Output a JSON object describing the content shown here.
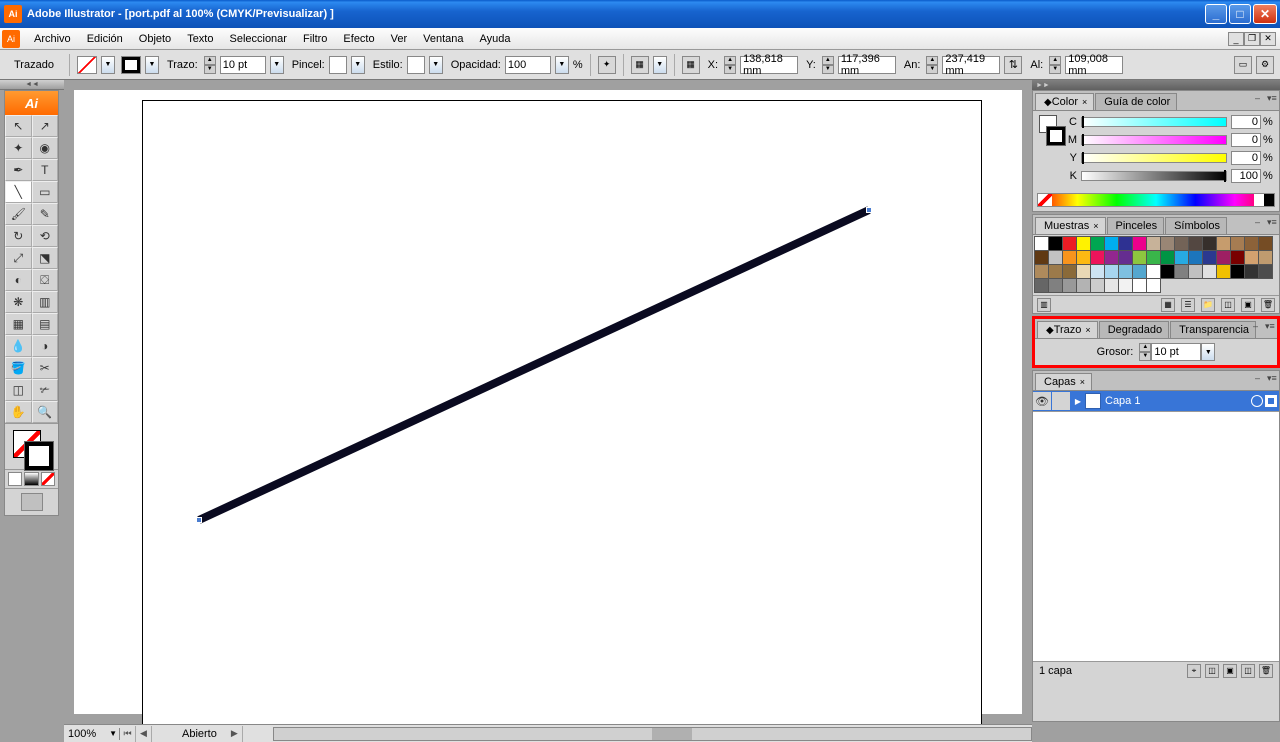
{
  "title": "Adobe Illustrator - [port.pdf al 100% (CMYK/Previsualizar) ]",
  "menu": [
    "Archivo",
    "Edición",
    "Objeto",
    "Texto",
    "Seleccionar",
    "Filtro",
    "Efecto",
    "Ver",
    "Ventana",
    "Ayuda"
  ],
  "control": {
    "selection": "Trazado",
    "trazo_label": "Trazo:",
    "trazo_value": "10 pt",
    "pincel_label": "Pincel:",
    "estilo_label": "Estilo:",
    "opacidad_label": "Opacidad:",
    "opacidad_value": "100",
    "opacidad_unit": "%",
    "x_label": "X:",
    "x_value": "138,818 mm",
    "y_label": "Y:",
    "y_value": "117,396 mm",
    "w_label": "An:",
    "w_value": "237,419 mm",
    "h_label": "Al:",
    "h_value": "109,008 mm"
  },
  "panels": {
    "color": {
      "tabs": [
        "Color",
        "Guía de color"
      ],
      "channels": [
        {
          "label": "C",
          "value": "0"
        },
        {
          "label": "M",
          "value": "0"
        },
        {
          "label": "Y",
          "value": "0"
        },
        {
          "label": "K",
          "value": "100"
        }
      ],
      "pct": "%"
    },
    "swatches": {
      "tabs": [
        "Muestras",
        "Pinceles",
        "Símbolos"
      ],
      "colors_row1": [
        "#ffffff",
        "#000000",
        "#ed1c24",
        "#fff200",
        "#00a651",
        "#00aeef",
        "#2e3192",
        "#ec008c",
        "#c7b299",
        "#998675",
        "#736357",
        "#534741",
        "#362f2b",
        "#c69c6d",
        "#a67c52",
        "#8c6239"
      ],
      "colors_row2": [
        "#754c24",
        "#603913",
        "#c2c2c2",
        "#f7941d",
        "#fdb913",
        "#ed145b",
        "#92278f",
        "#652d90",
        "#8dc63f",
        "#39b54a",
        "#009444",
        "#27aae1",
        "#1c75bc",
        "#2b3990",
        "#9e1f63",
        "#790000"
      ],
      "colors_row3": [
        "#d3a16f",
        "#bf9b6f",
        "#ae8a5c",
        "#9c7a4a",
        "#8a6a39",
        "#e9d8b5",
        "#cde3f2",
        "#a7d5ee",
        "#7ec0e0",
        "#54a7cf",
        "#ffffff",
        "#000000",
        "#808080",
        "#c0c0c0",
        "#e0e0e0",
        "#f0c000"
      ],
      "colors_row4": [
        "#000000",
        "#333333",
        "#4d4d4d",
        "#666666",
        "#808080",
        "#999999",
        "#b3b3b3",
        "#cccccc",
        "#e6e6e6",
        "#f2f2f2",
        "#ffffff",
        "#ffffff"
      ]
    },
    "stroke": {
      "tabs": [
        "Trazo",
        "Degradado",
        "Transparencia"
      ],
      "grosor_label": "Grosor:",
      "grosor_value": "10 pt"
    },
    "layers": {
      "tabs": [
        "Capas"
      ],
      "layer_name": "Capa 1",
      "footer": "1 capa"
    }
  },
  "status": {
    "zoom": "100%",
    "state": "Abierto"
  }
}
